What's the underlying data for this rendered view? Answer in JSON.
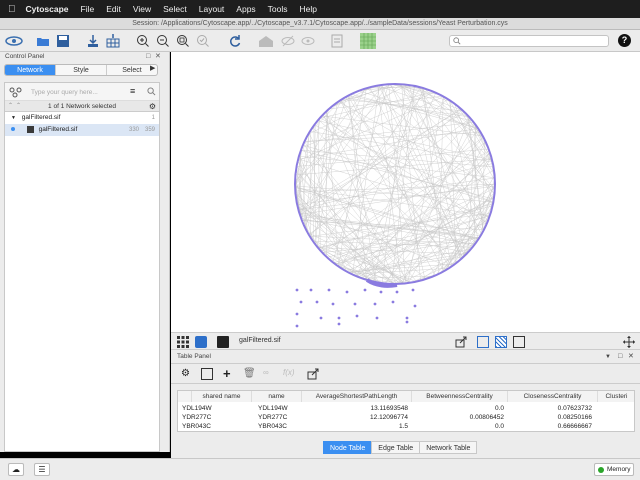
{
  "menubar": {
    "app": "Cytoscape",
    "items": [
      "File",
      "Edit",
      "View",
      "Select",
      "Layout",
      "Apps",
      "Tools",
      "Help"
    ]
  },
  "window": {
    "title": "Session: /Applications/Cytoscape.app/../Cytoscape_v3.7.1/Cytoscape.app/../sampleData/sessions/Yeast Perturbation.cys"
  },
  "control_panel": {
    "title": "Control Panel",
    "tabs": [
      "Network",
      "Style",
      "Select"
    ],
    "active_tab": "Network",
    "query_placeholder": "Type your query here...",
    "status": "1 of 1 Network selected",
    "collection": "galFiltered.sif",
    "network": "galFiltered.sif",
    "node_count": "330",
    "edge_count": "359",
    "collection_count": "1"
  },
  "network_view": {
    "name": "galFiltered.sif",
    "node_color": "#8a7be0"
  },
  "table_panel": {
    "title": "Table Panel",
    "columns": [
      "shared name",
      "name",
      "AverageShortestPathLength",
      "BetweennessCentrality",
      "ClosenessCentrality",
      "Clusteri"
    ],
    "rows": [
      [
        "YDL194W",
        "YDL194W",
        "13.11693548",
        "0.0",
        "0.07623732"
      ],
      [
        "YDR277C",
        "YDR277C",
        "12.12096774",
        "0.00806452",
        "0.08250166"
      ],
      [
        "YBR043C",
        "YBR043C",
        "1.5",
        "0.0",
        "0.66666667"
      ]
    ],
    "tabs": [
      "Node Table",
      "Edge Table",
      "Network Table"
    ],
    "active_tab": "Node Table"
  },
  "statusbar": {
    "memory_label": "Memory"
  },
  "colors": {
    "accent": "#3b8ff1",
    "node": "#8a7be0"
  }
}
